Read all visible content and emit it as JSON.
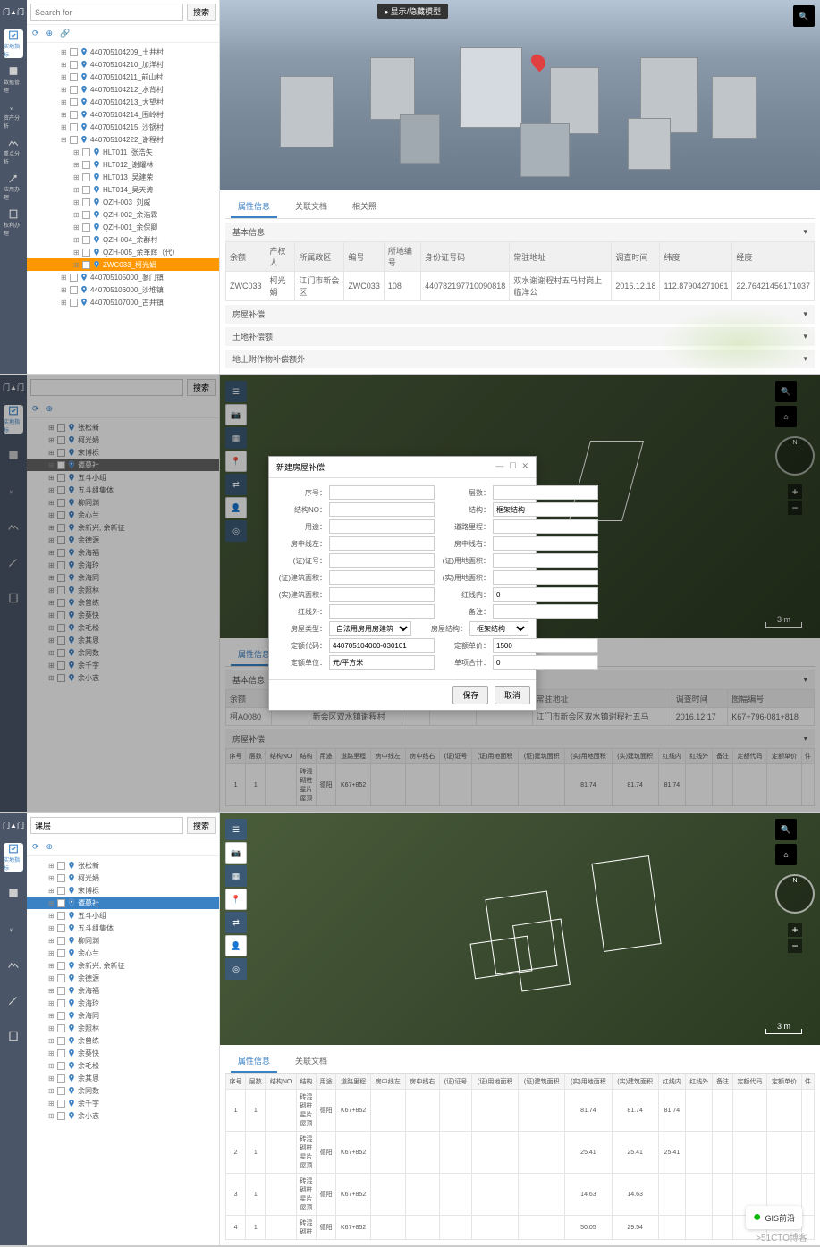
{
  "search": {
    "placeholder": "Search for",
    "btn": "搜索",
    "layer_label": "课层"
  },
  "nav_items": [
    "实地指标",
    "数据管理",
    "资产分析",
    "重点分析",
    "应用办理",
    "权利办理"
  ],
  "tree1": [
    {
      "label": "440705104209_土井村",
      "indent": 2
    },
    {
      "label": "440705104210_加洋村",
      "indent": 2
    },
    {
      "label": "440705104211_前山村",
      "indent": 2
    },
    {
      "label": "440705104212_水背村",
      "indent": 2
    },
    {
      "label": "440705104213_大望村",
      "indent": 2
    },
    {
      "label": "440705104214_围岭村",
      "indent": 2
    },
    {
      "label": "440705104215_沙锅村",
      "indent": 2
    },
    {
      "label": "440705104222_谢程村",
      "indent": 2,
      "expanded": true
    },
    {
      "label": "HLT011_张浩矢",
      "indent": 3
    },
    {
      "label": "HLT012_谢耀林",
      "indent": 3
    },
    {
      "label": "HLT013_吴建荣",
      "indent": 3
    },
    {
      "label": "HLT014_吴天涛",
      "indent": 3
    },
    {
      "label": "QZH-003_刘威",
      "indent": 3
    },
    {
      "label": "QZH-002_余浩霖",
      "indent": 3
    },
    {
      "label": "QZH-001_余保卿",
      "indent": 3
    },
    {
      "label": "QZH-004_余群村",
      "indent": 3
    },
    {
      "label": "QZH-005_余革辉（代）",
      "indent": 3
    },
    {
      "label": "ZWC033_柯光娟",
      "indent": 3,
      "selected_orange": true
    },
    {
      "label": "440705105000_蓼门镇",
      "indent": 2
    },
    {
      "label": "440705106000_沙堆镇",
      "indent": 2
    },
    {
      "label": "440705107000_古井镇",
      "indent": 2
    }
  ],
  "tree2": [
    {
      "label": "张松新",
      "indent": 1
    },
    {
      "label": "柯光娟",
      "indent": 1
    },
    {
      "label": "宋博栎",
      "indent": 1
    },
    {
      "label": "谭墓社",
      "indent": 1,
      "selected_gray": true
    },
    {
      "label": "五斗小组",
      "indent": 1
    },
    {
      "label": "五斗组集体",
      "indent": 1
    },
    {
      "label": "柳同渊",
      "indent": 1
    },
    {
      "label": "余心兰",
      "indent": 1
    },
    {
      "label": "余新兴, 余新征",
      "indent": 1
    },
    {
      "label": "余德源",
      "indent": 1
    },
    {
      "label": "余海福",
      "indent": 1
    },
    {
      "label": "余海玲",
      "indent": 1
    },
    {
      "label": "余海同",
      "indent": 1
    },
    {
      "label": "余照林",
      "indent": 1
    },
    {
      "label": "余曾练",
      "indent": 1
    },
    {
      "label": "余葵快",
      "indent": 1
    },
    {
      "label": "余毛松",
      "indent": 1
    },
    {
      "label": "余其恩",
      "indent": 1
    },
    {
      "label": "余同数",
      "indent": 1
    },
    {
      "label": "余千字",
      "indent": 1
    },
    {
      "label": "余小志",
      "indent": 1
    }
  ],
  "tree3": [
    {
      "label": "张松新",
      "indent": 1
    },
    {
      "label": "柯光娟",
      "indent": 1
    },
    {
      "label": "宋博栎",
      "indent": 1
    },
    {
      "label": "谭墓社",
      "indent": 1,
      "selected": true
    },
    {
      "label": "五斗小组",
      "indent": 1
    },
    {
      "label": "五斗组集体",
      "indent": 1
    },
    {
      "label": "柳同渊",
      "indent": 1
    },
    {
      "label": "余心兰",
      "indent": 1
    },
    {
      "label": "余新兴, 余新征",
      "indent": 1
    },
    {
      "label": "余德源",
      "indent": 1
    },
    {
      "label": "余海福",
      "indent": 1
    },
    {
      "label": "余海玲",
      "indent": 1
    },
    {
      "label": "余海同",
      "indent": 1
    },
    {
      "label": "余照林",
      "indent": 1
    },
    {
      "label": "余曾练",
      "indent": 1
    },
    {
      "label": "余葵快",
      "indent": 1
    },
    {
      "label": "余毛松",
      "indent": 1
    },
    {
      "label": "余其恩",
      "indent": 1
    },
    {
      "label": "余同数",
      "indent": 1
    },
    {
      "label": "余千字",
      "indent": 1
    },
    {
      "label": "余小志",
      "indent": 1
    }
  ],
  "viewer_toggle": "显示/隐藏模型",
  "tabs1": [
    "属性信息",
    "关联文档",
    "相关照"
  ],
  "tabs3": [
    "属性信息",
    "关联文档"
  ],
  "collapse": {
    "basic": "基本信息",
    "house": "房屋补偿",
    "land": "土地补偿额",
    "attach": "地上附作物补偿额外"
  },
  "prop_headers": [
    "余额",
    "产权人",
    "所属政区",
    "编号",
    "所地编号",
    "身份证号码",
    "常驻地址",
    "调查时间",
    "纬度",
    "经度"
  ],
  "prop_row": [
    "ZWC033",
    "柯光娟",
    "江门市新会区",
    "ZWC033",
    "108",
    "440782197710090818",
    "双水谢谢程村五马村岗上临洋公",
    "2016.12.18",
    "112.87904271061",
    "22.76421456171037"
  ],
  "prop_headers2": [
    "余额",
    "产权人",
    "所属政区",
    "编号",
    "所地编号",
    "身份证号码",
    "常驻地址",
    "调查时间",
    "图幅编号"
  ],
  "prop_row2": [
    "柯A0080",
    "",
    "新会区双水镇谢程村",
    "",
    "",
    "",
    "江门市新会区双水镇谢程社五马",
    "2016.12.17",
    "K67+796-081+818"
  ],
  "table_headers": [
    "序号",
    "层数",
    "结构NO",
    "结构",
    "用途",
    "道路里程",
    "房中线左",
    "房中线右",
    "(证)证号",
    "(证)用地面积",
    "(证)建筑面积",
    "(实)用地面积",
    "(实)建筑面积",
    "红线内",
    "红线外",
    "备注",
    "定额代码",
    "定额单价",
    "件"
  ],
  "table_rows": [
    {
      "seq": "1",
      "floor": "1",
      "struct": "砖混\n砌柱\n星片\n屋顶",
      "use": "德阳",
      "road": "K67+852",
      "area1": "81.74",
      "area2": "81.74",
      "area3": "81.74"
    },
    {
      "seq": "2",
      "floor": "1",
      "struct": "砖混\n砌柱\n星片\n屋顶",
      "use": "德阳",
      "road": "K67+852",
      "area1": "25.41",
      "area2": "25.41",
      "area3": "25.41"
    },
    {
      "seq": "3",
      "floor": "1",
      "struct": "砖混\n砌柱\n星片\n屋顶",
      "use": "德阳",
      "road": "K67+852",
      "area1": "14.63",
      "area2": "14.63",
      "area3": ""
    },
    {
      "seq": "4",
      "floor": "1",
      "struct": "砖混\n砌柱",
      "use": "德阳",
      "road": "K67+852",
      "area1": "50.05",
      "area2": "29.54",
      "area3": ""
    }
  ],
  "dialog": {
    "title": "新建房屋补偿",
    "labels": {
      "seq": "序号：",
      "floor": "层数：",
      "structno": "结构NO：",
      "struct": "结构：",
      "use": "用途：",
      "road": "道路里程：",
      "left": "房中线左：",
      "right": "房中线右：",
      "cert": "(证)证号：",
      "certland": "(证)用地面积：",
      "certbuild": "(证)建筑面积：",
      "realland": "(实)用地面积：",
      "realbuild": "(实)建筑面积：",
      "in": "红线内：",
      "out": "红线外：",
      "remark": "备注：",
      "htype": "房屋类型：",
      "hstruct": "房屋结构：",
      "code": "定额代码：",
      "unit": "定额单价：",
      "unitname": "定额单位：",
      "total": "单项合计："
    },
    "values": {
      "struct": "框架结构",
      "htype": "自法用房用房建筑",
      "hstruct": "框架结构",
      "code": "440705104000-030101",
      "unit": "1500",
      "unitname": "元/平方米",
      "in": "0",
      "total": "0"
    },
    "btn_save": "保存",
    "btn_cancel": "取消"
  },
  "scale": "3 m",
  "wechat": "GIS前沿",
  "blog": ">51CTO博客"
}
